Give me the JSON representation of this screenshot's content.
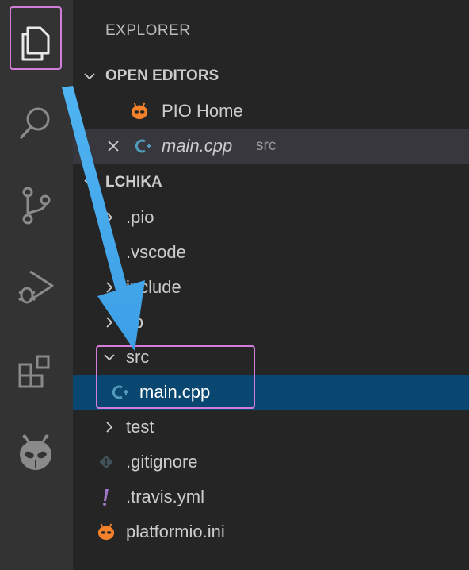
{
  "explorer": {
    "title": "EXPLORER",
    "open_editors_label": "OPEN EDITORS",
    "open_editors": [
      {
        "label": "PIO Home",
        "desc": ""
      },
      {
        "label": "main.cpp",
        "desc": "src"
      }
    ],
    "project_label": "LCHIKA",
    "tree": [
      {
        "label": ".pio"
      },
      {
        "label": ".vscode"
      },
      {
        "label": "include"
      },
      {
        "label": "lib"
      },
      {
        "label": "src"
      },
      {
        "label": "main.cpp"
      },
      {
        "label": "test"
      },
      {
        "label": ".gitignore"
      },
      {
        "label": ".travis.yml"
      },
      {
        "label": "platformio.ini"
      }
    ]
  },
  "icons": {
    "activity": [
      "files-icon",
      "search-icon",
      "source-control-icon",
      "run-debug-icon",
      "extensions-icon",
      "platformio-icon"
    ],
    "cpp_file": "cpp-file-icon",
    "platformio_file": "platformio-icon",
    "git_file": "git-icon",
    "yaml_file": "exclamation-icon"
  },
  "colors": {
    "highlight": "#d27ed8",
    "arrow": "#4fb4f2",
    "selected_row": "#094771",
    "platformio_orange": "#f5822a",
    "cpp_blue": "#519aba"
  }
}
